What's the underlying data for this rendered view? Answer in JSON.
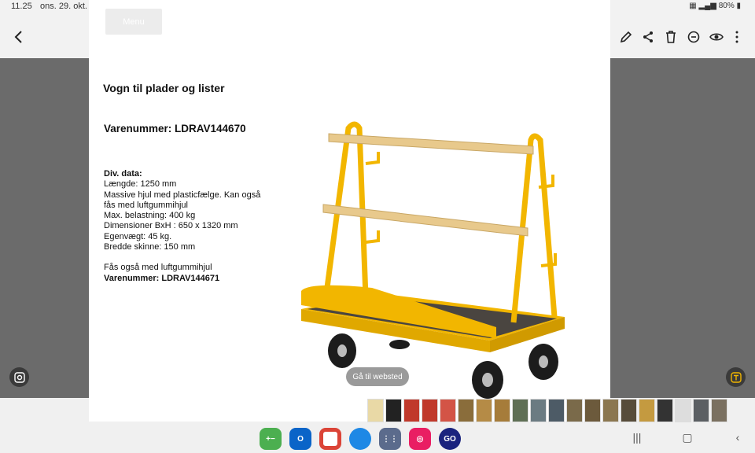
{
  "status_bar": {
    "time": "11.25",
    "date": "ons. 29. okt.",
    "battery": "80%"
  },
  "document": {
    "menu_label": "Menu",
    "title": "Vogn til plader og lister",
    "item_number": "Varenummer: LDRAV144670",
    "specs_heading": "Div. data:",
    "specs": [
      "Længde: 1250 mm",
      "Massive hjul med plasticfælge. Kan også fås med luftgummihjul",
      "Max. belastning: 400 kg",
      "Dimensioner BxH : 650 x 1320 mm",
      "Egenvægt: 45 kg.",
      "Bredde skinne: 150 mm"
    ],
    "note": "Fås også med luftgummihjul",
    "alt_item_number": "Varenummer: LDRAV144671"
  },
  "overlay": {
    "goto_label": "Gå til websted"
  },
  "toolbar_icons": [
    "back-icon",
    "heart-icon",
    "edit-icon",
    "share-icon",
    "delete-icon",
    "remaster-icon",
    "eye-icon",
    "more-icon"
  ],
  "taskbar_apps": [
    {
      "name": "calculator",
      "label": "+−",
      "color": "#4caf50"
    },
    {
      "name": "outlook",
      "label": "O",
      "color": "#0a64c8"
    },
    {
      "name": "chrome",
      "label": "",
      "color": "#db4437"
    },
    {
      "name": "edge",
      "label": "",
      "color": "#1e88e5"
    },
    {
      "name": "apps-grid",
      "label": "⋮⋮",
      "color": "#5b6b8c"
    },
    {
      "name": "camera",
      "label": "◎",
      "color": "#e91e63"
    },
    {
      "name": "go",
      "label": "GO",
      "color": "#1a237e"
    }
  ],
  "colors": {
    "accent_yellow": "#f2b600",
    "wood": "#e8c98c"
  }
}
